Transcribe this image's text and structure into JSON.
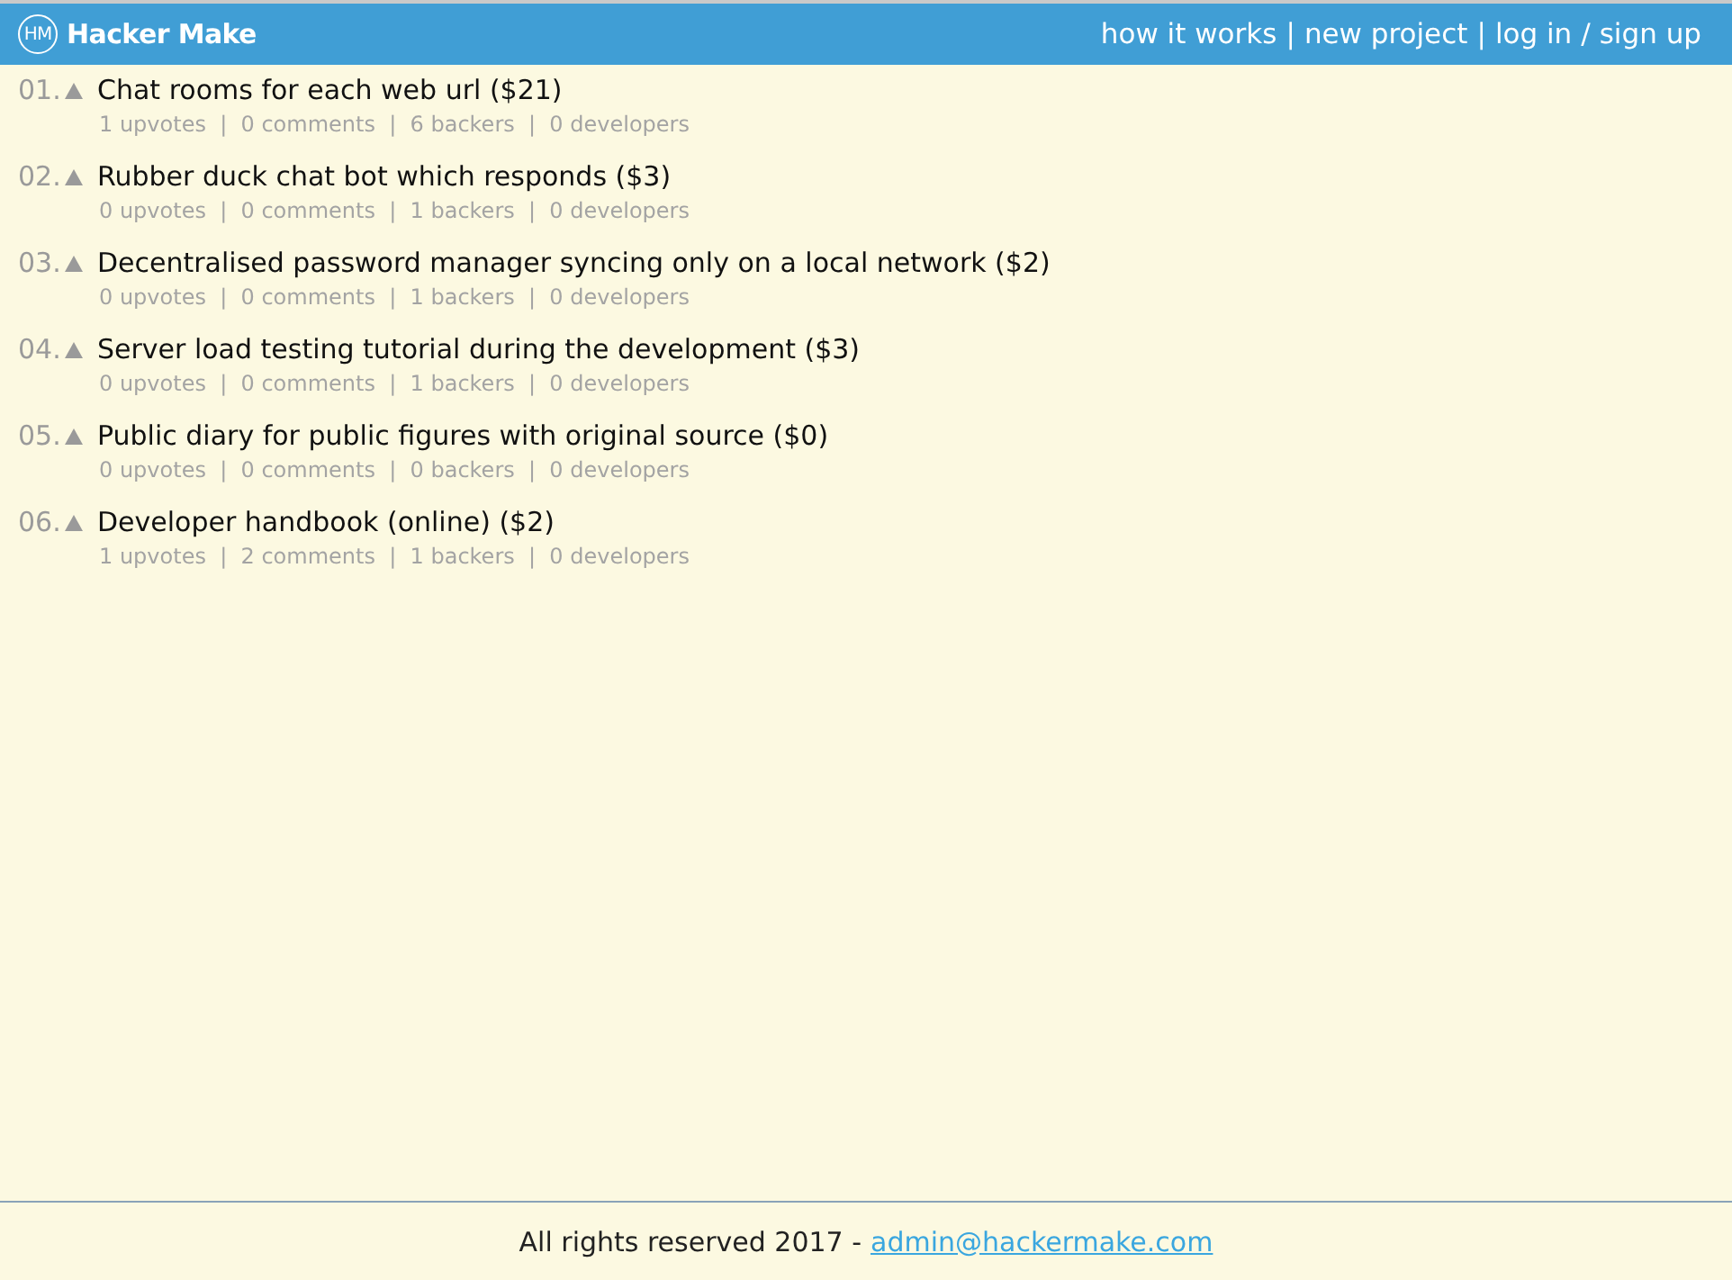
{
  "header": {
    "logo_mark": "HM",
    "site_name": "Hacker Make",
    "nav": [
      {
        "label": "how it works",
        "separator": "|"
      },
      {
        "label": "new project",
        "separator": "|"
      },
      {
        "label": "log in",
        "separator": "/"
      },
      {
        "label": "sign up"
      }
    ]
  },
  "projects": [
    {
      "rank": "01.",
      "title": "Chat rooms for each web url ($21)",
      "meta": "1 upvotes  |  0 comments  |  6 backers  |  0 developers"
    },
    {
      "rank": "02.",
      "title": "Rubber duck chat bot which responds ($3)",
      "meta": "0 upvotes  |  0 comments  |  1 backers  |  0 developers"
    },
    {
      "rank": "03.",
      "title": "Decentralised password manager syncing only on a local network ($2)",
      "meta": "0 upvotes  |  0 comments  |  1 backers  |  0 developers"
    },
    {
      "rank": "04.",
      "title": "Server load testing tutorial during the development ($3)",
      "meta": "0 upvotes  |  0 comments  |  1 backers  |  0 developers"
    },
    {
      "rank": "05.",
      "title": "Public diary for public figures with original source ($0)",
      "meta": "0 upvotes  |  0 comments  |  0 backers  |  0 developers"
    },
    {
      "rank": "06.",
      "title": "Developer handbook (online) ($2)",
      "meta": "1 upvotes  |  2 comments  |  1 backers  |  0 developers"
    }
  ],
  "footer": {
    "text": "All rights reserved 2017 -",
    "email": "admin@hackermake.com"
  }
}
